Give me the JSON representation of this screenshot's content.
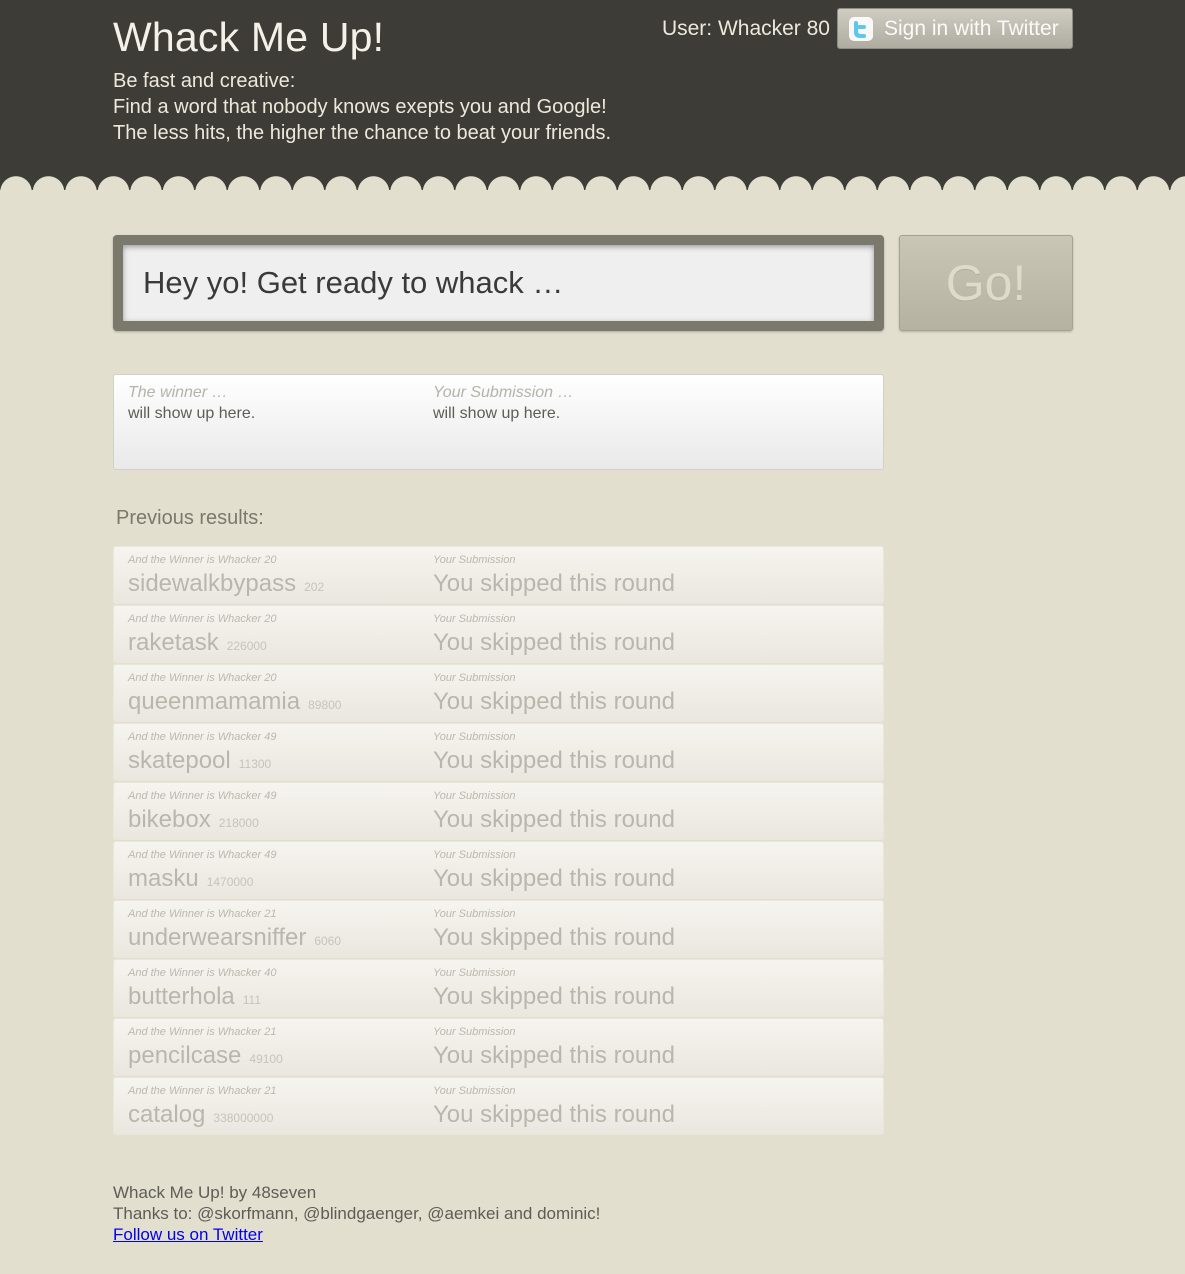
{
  "header": {
    "title": "Whack Me Up!",
    "tagline": [
      "Be fast and creative:",
      "Find a word that nobody knows exepts you and Google!",
      "The less hits, the higher the chance to beat your friends."
    ],
    "user_label": "User: Whacker 80",
    "signin_label": "Sign in with Twitter"
  },
  "game": {
    "input_placeholder": "Hey yo! Get ready to whack …",
    "go_label": "Go!"
  },
  "current_result": {
    "winner_label": "The winner …",
    "winner_value": "will show up here.",
    "submission_label": "Your Submission …",
    "submission_value": "will show up here."
  },
  "previous": {
    "heading": "Previous results:",
    "rows": [
      {
        "winner_label": "And the Winner is Whacker 20",
        "word": "sidewalkbypass",
        "hits": "202",
        "sub_label": "Your Submission",
        "sub_value": "You skipped this round"
      },
      {
        "winner_label": "And the Winner is Whacker 20",
        "word": "raketask",
        "hits": "226000",
        "sub_label": "Your Submission",
        "sub_value": "You skipped this round"
      },
      {
        "winner_label": "And the Winner is Whacker 20",
        "word": "queenmamamia",
        "hits": "89800",
        "sub_label": "Your Submission",
        "sub_value": "You skipped this round"
      },
      {
        "winner_label": "And the Winner is Whacker 49",
        "word": "skatepool",
        "hits": "11300",
        "sub_label": "Your Submission",
        "sub_value": "You skipped this round"
      },
      {
        "winner_label": "And the Winner is Whacker 49",
        "word": "bikebox",
        "hits": "218000",
        "sub_label": "Your Submission",
        "sub_value": "You skipped this round"
      },
      {
        "winner_label": "And the Winner is Whacker 49",
        "word": "masku",
        "hits": "1470000",
        "sub_label": "Your Submission",
        "sub_value": "You skipped this round"
      },
      {
        "winner_label": "And the Winner is Whacker 21",
        "word": "underwearsniffer",
        "hits": "6060",
        "sub_label": "Your Submission",
        "sub_value": "You skipped this round"
      },
      {
        "winner_label": "And the Winner is Whacker 40",
        "word": "butterhola",
        "hits": "111",
        "sub_label": "Your Submission",
        "sub_value": "You skipped this round"
      },
      {
        "winner_label": "And the Winner is Whacker 21",
        "word": "pencilcase",
        "hits": "49100",
        "sub_label": "Your Submission",
        "sub_value": "You skipped this round"
      },
      {
        "winner_label": "And the Winner is Whacker 21",
        "word": "catalog",
        "hits": "338000000",
        "sub_label": "Your Submission",
        "sub_value": "You skipped this round"
      }
    ]
  },
  "footer": {
    "credit": "Whack Me Up! by 48seven",
    "thanks": "Thanks to: @skorfmann, @blindgaenger, @aemkei and dominic!",
    "follow_link": "Follow us on Twitter"
  },
  "colors": {
    "header_bg": "#3e3c37",
    "page_bg": "#e2dfcf",
    "twitter_bird": "#5ec7ee"
  },
  "icons": {
    "twitter": "twitter-bird-icon"
  }
}
